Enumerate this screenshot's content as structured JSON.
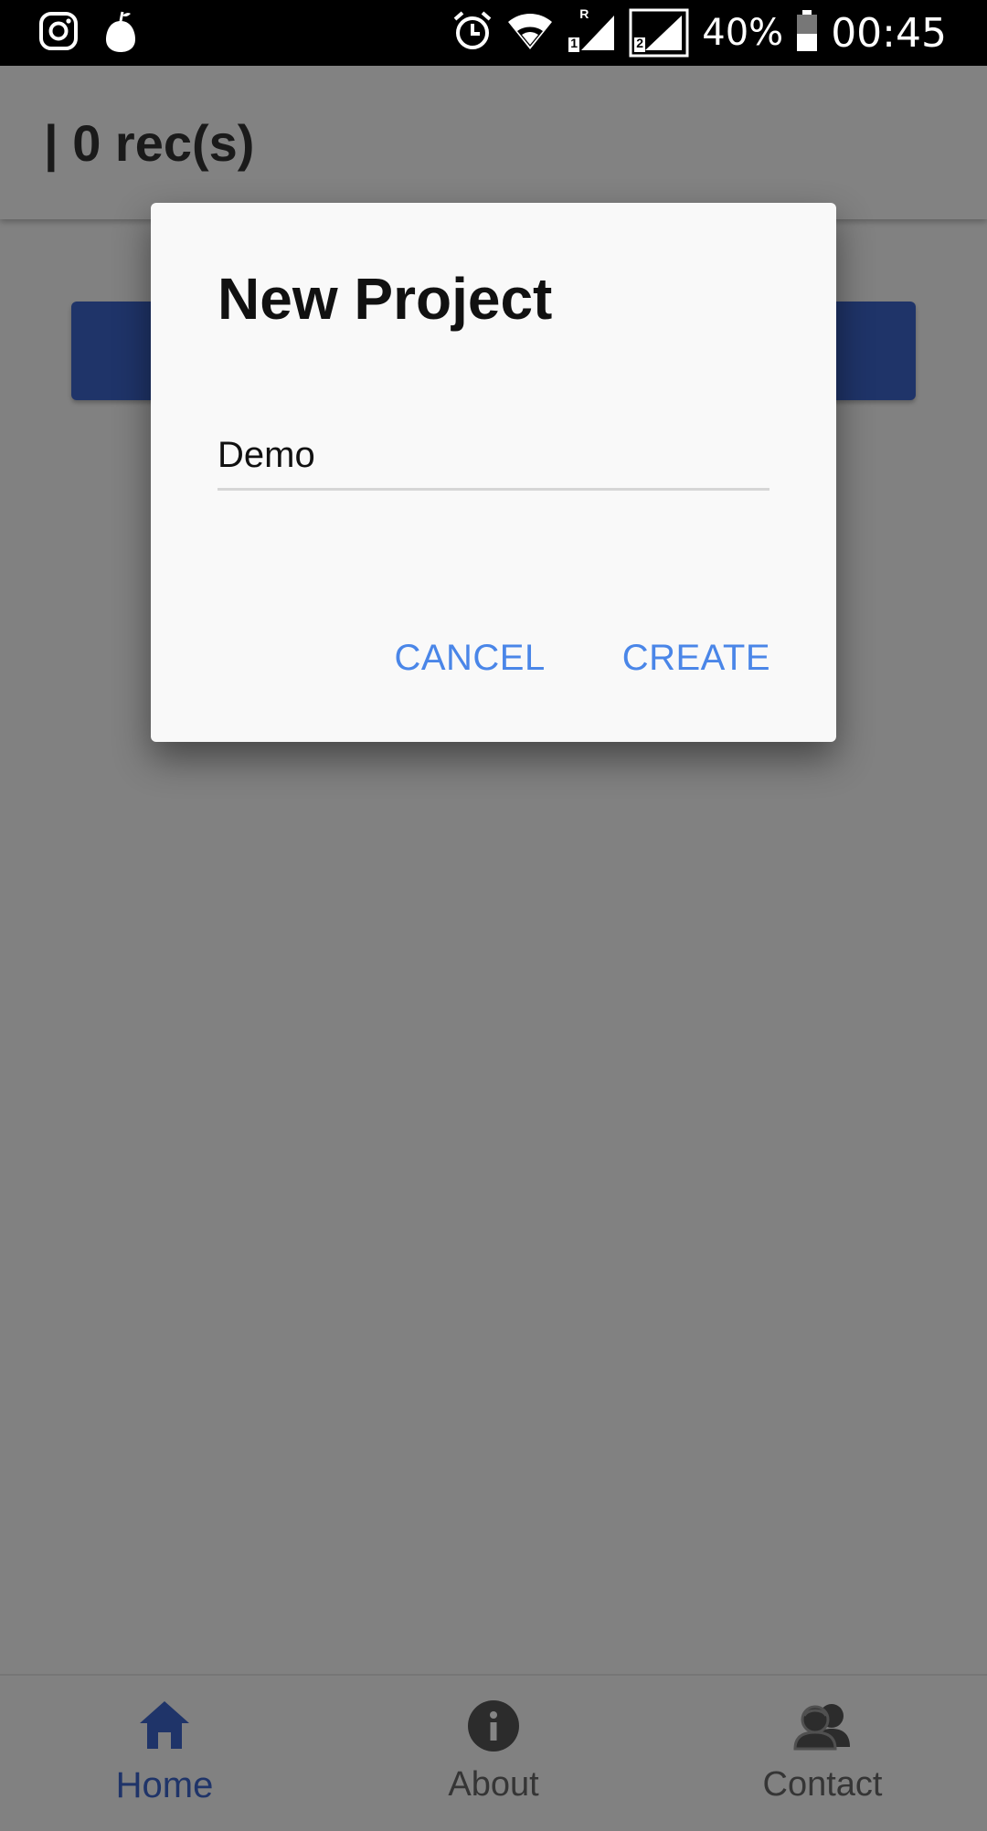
{
  "status_bar": {
    "battery_percent": "40%",
    "clock": "00:45",
    "sim1_label": "R",
    "sim1_slot": "1",
    "sim2_slot": "2",
    "icons": [
      "instagram-icon",
      "pear-app-icon",
      "alarm-icon",
      "wifi-icon",
      "signal-sim1-icon",
      "signal-sim2-icon",
      "battery-icon"
    ]
  },
  "app_bar": {
    "title": "| 0 rec(s)"
  },
  "primary_button_color": "#3d64c9",
  "dialog": {
    "title": "New Project",
    "input_value": "Demo",
    "cancel_label": "CANCEL",
    "create_label": "CREATE",
    "accent_color": "#4a86e8"
  },
  "tabs": [
    {
      "label": "Home",
      "icon": "home-icon",
      "active": true
    },
    {
      "label": "About",
      "icon": "info-icon",
      "active": false
    },
    {
      "label": "Contact",
      "icon": "contacts-icon",
      "active": false
    }
  ]
}
